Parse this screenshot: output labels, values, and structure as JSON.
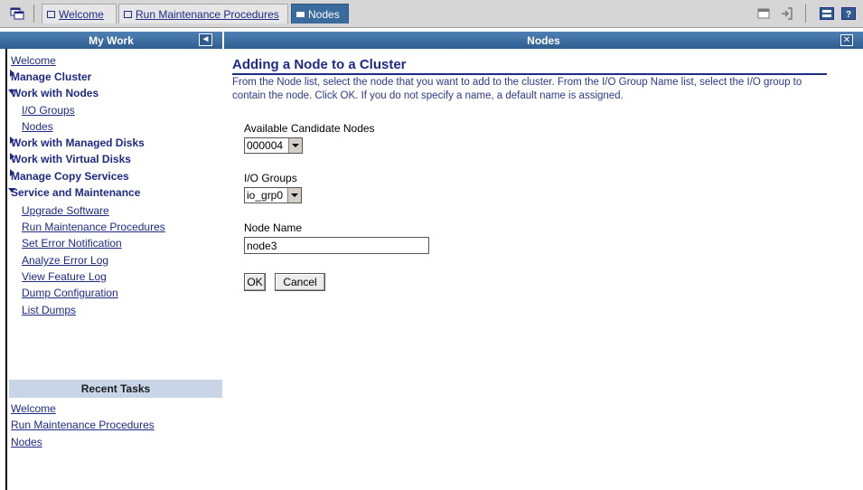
{
  "tabs": [
    {
      "label": "Welcome"
    },
    {
      "label": "Run Maintenance Procedures"
    },
    {
      "label": "Nodes"
    }
  ],
  "toolbar_icons": [
    "windows-icon",
    "restore-icon",
    "logout-icon",
    "taskbar-icon",
    "help-icon"
  ],
  "left_panel": {
    "title": "My Work",
    "items": [
      {
        "label": "Welcome",
        "kind": "link"
      },
      {
        "label": "Manage Cluster",
        "kind": "group",
        "expanded": false
      },
      {
        "label": "Work with Nodes",
        "kind": "group",
        "expanded": true
      },
      {
        "label": "I/O Groups",
        "kind": "sublink"
      },
      {
        "label": "Nodes",
        "kind": "sublink"
      },
      {
        "label": "Work with Managed Disks",
        "kind": "group",
        "expanded": false
      },
      {
        "label": "Work with Virtual Disks",
        "kind": "group",
        "expanded": false
      },
      {
        "label": "Manage Copy Services",
        "kind": "group",
        "expanded": false
      },
      {
        "label": "Service and Maintenance",
        "kind": "group",
        "expanded": true
      },
      {
        "label": "Upgrade Software",
        "kind": "sublink"
      },
      {
        "label": "Run Maintenance Procedures",
        "kind": "sublink"
      },
      {
        "label": "Set Error Notification",
        "kind": "sublink"
      },
      {
        "label": "Analyze Error Log",
        "kind": "sublink"
      },
      {
        "label": "View Feature Log",
        "kind": "sublink"
      },
      {
        "label": "Dump Configuration",
        "kind": "sublink"
      },
      {
        "label": "List Dumps",
        "kind": "sublink"
      }
    ],
    "recent_title": "Recent Tasks",
    "recent": [
      {
        "label": "Welcome"
      },
      {
        "label": "Run Maintenance Procedures"
      },
      {
        "label": "Nodes"
      }
    ]
  },
  "main": {
    "header": "Nodes",
    "page_title": "Adding a Node to a Cluster",
    "instructions": "From the Node list, select the node that you want to add to the cluster. From the I/O Group Name list, select the I/O group to contain the node. Click OK. If you do not specify a name, a default name is assigned.",
    "candidate_label": "Available Candidate Nodes",
    "candidate_value": "000004",
    "iogroup_label": "I/O Groups",
    "iogroup_value": "io_grp0",
    "node_name_label": "Node Name",
    "node_name_value": "node3",
    "ok_label": "OK",
    "cancel_label": "Cancel"
  },
  "colors": {
    "header_blue": "#2f5d8f",
    "link_blue": "#1d2a86",
    "active_tab": "#3b6a9d",
    "recent_header_bg": "#c7d5e6"
  }
}
